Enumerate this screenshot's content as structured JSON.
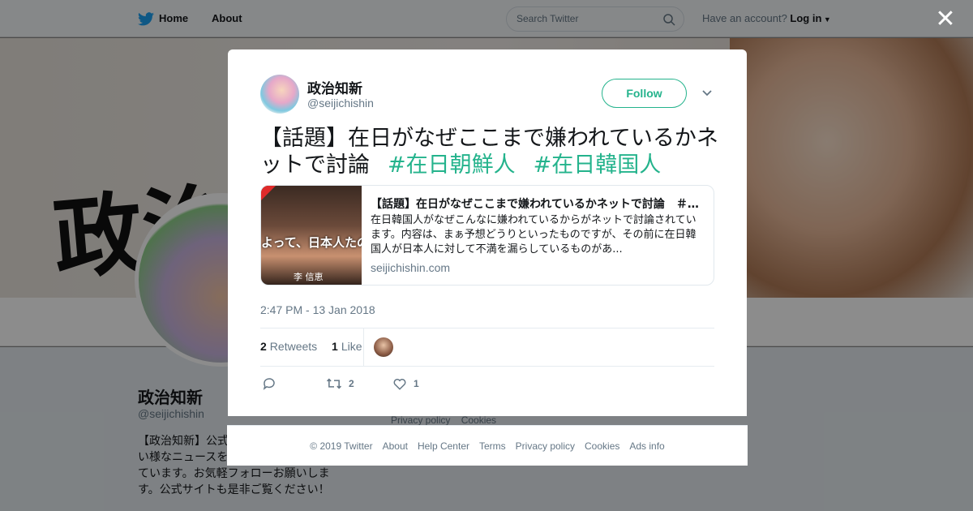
{
  "topnav": {
    "home_label": "Home",
    "about_label": "About",
    "search_placeholder": "Search Twitter",
    "account_prompt": "Have an account?",
    "login_label": "Log in"
  },
  "profile": {
    "name": "政治知新",
    "handle": "@seijichishin",
    "bio": "【政治知新】公式 スをメインにマス ない様なニュースを中心に日々つぶやい ています。お気軽フォローお願いしま す。公式サイトも是非ご覧ください！",
    "side_links": [
      "Privacy policy",
      "Cookies"
    ],
    "banner_text": "政治"
  },
  "tweet": {
    "author_name": "政治知新",
    "author_handle": "@seijichishin",
    "follow_label": "Follow",
    "text": "【話題】在日がなぜここまで嫌われているかネットで討論",
    "hashtags": [
      "#在日朝鮮人",
      "#在日韓国人"
    ],
    "card": {
      "image_caption": "よって、日本人たのじゃないでしょ",
      "image_name": "李 信恵",
      "title": "【話題】在日がなぜここまで嫌われているかネットで討論　＃…",
      "description": "在日韓国人がなぜこんなに嫌われているからがネットで討論されています。内容は、まぁ予想どうりといったものですが、その前に在日韓国人が日本人に対して不満を漏らしているものがあ...",
      "domain": "seijichishin.com"
    },
    "timestamp": "2:47 PM - 13 Jan 2018",
    "retweets_count": "2",
    "retweets_label": "Retweets",
    "likes_count": "1",
    "likes_label": "Like",
    "actions": {
      "retweet_count": "2",
      "like_count": "1"
    }
  },
  "footer": {
    "links": [
      "© 2019 Twitter",
      "About",
      "Help Center",
      "Terms",
      "Privacy policy",
      "Cookies",
      "Ads info"
    ]
  },
  "colors": {
    "accent": "#24b38c",
    "muted": "#657786",
    "twitter_blue": "#1da1f2"
  }
}
